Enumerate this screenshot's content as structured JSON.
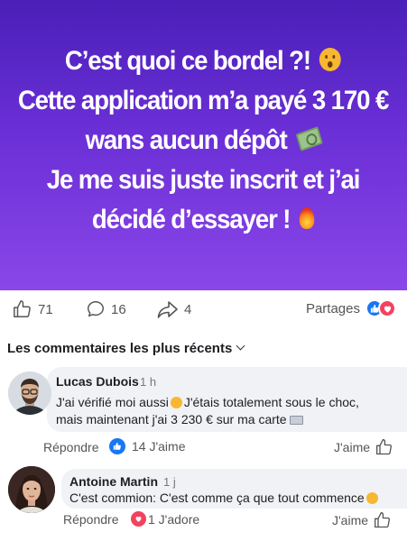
{
  "hero": {
    "line1": "C’est quoi ce bordel ?!",
    "line2": "Cette application m’a payé 3 170 €",
    "line3": "wans aucun dépôt",
    "line4": "Je me suis juste inscrit et j’ai",
    "line5": "décidé d’essayer !",
    "background": "#6a2fd6"
  },
  "stats": {
    "likes": "71",
    "comments": "16",
    "shares_count": "4",
    "shares_label": "Partages"
  },
  "section": {
    "title": "Les commentaires les plus récents"
  },
  "comments": [
    {
      "author": "Lucas Dubois",
      "time": "1 h",
      "line1_a": "J'ai vérifié moi aussi",
      "line1_b": "J'étais totalement sous le choc,",
      "line2": "mais maintenant j'ai 3 230 € sur ma carte",
      "reply": "Répondre",
      "reactions": "14 J'aime",
      "like": "J'aime"
    },
    {
      "author": "Antoine Martin",
      "time": "1 j",
      "line1": "C'est commion: C'est comme ça que tout commence",
      "reply": "Répondre",
      "reactions": "1 J'adore",
      "like": "J'aime"
    }
  ],
  "colors": {
    "accent_blue": "#1877f2",
    "heart_red": "#f3425f",
    "muted": "#555555"
  }
}
